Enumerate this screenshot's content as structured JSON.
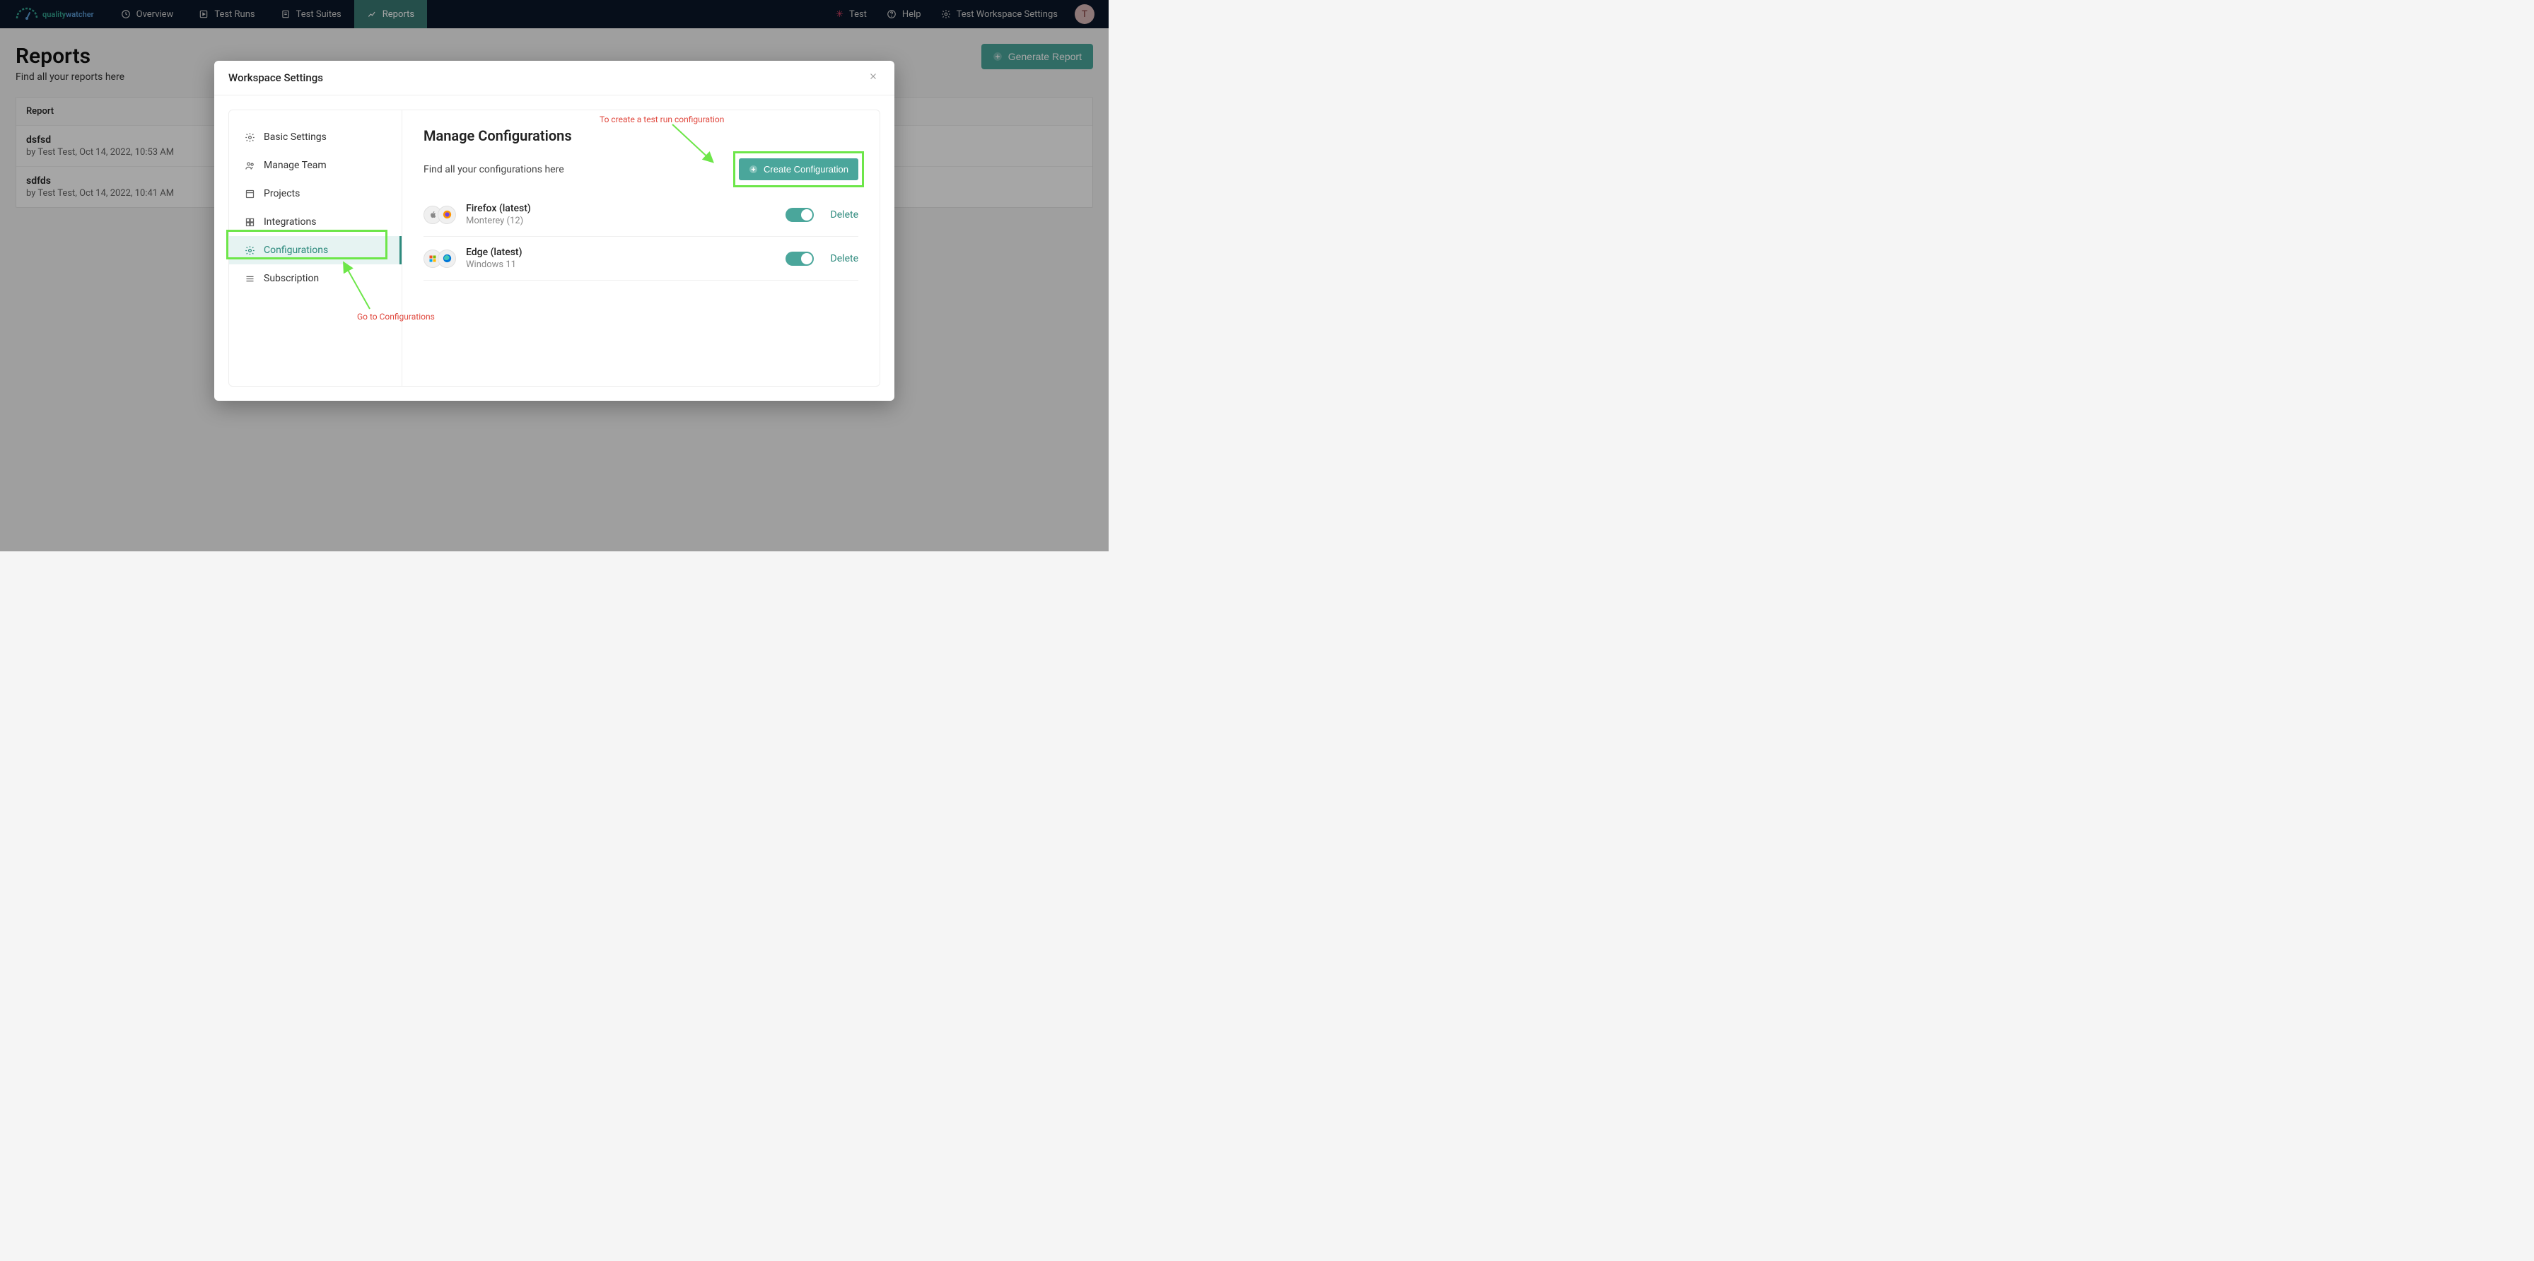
{
  "brand": {
    "name_a": "quality",
    "name_b": "watcher"
  },
  "nav": {
    "items": [
      {
        "label": "Overview"
      },
      {
        "label": "Test Runs"
      },
      {
        "label": "Test Suites"
      },
      {
        "label": "Reports"
      }
    ],
    "right": {
      "test": "Test",
      "help": "Help",
      "settings": "Test Workspace Settings",
      "avatar_initial": "T"
    }
  },
  "page": {
    "title": "Reports",
    "subtitle": "Find all your reports here",
    "generate_btn": "Generate Report",
    "column_header": "Report",
    "reports": [
      {
        "name": "dsfsd",
        "meta": "by Test Test, Oct 14, 2022, 10:53 AM"
      },
      {
        "name": "sdfds",
        "meta": "by Test Test, Oct 14, 2022, 10:41 AM"
      }
    ]
  },
  "modal": {
    "title": "Workspace Settings",
    "side": [
      {
        "label": "Basic Settings"
      },
      {
        "label": "Manage Team"
      },
      {
        "label": "Projects"
      },
      {
        "label": "Integrations"
      },
      {
        "label": "Configurations"
      },
      {
        "label": "Subscription"
      }
    ],
    "main": {
      "heading": "Manage Configurations",
      "sub": "Find all your configurations here",
      "create_btn": "Create Configuration",
      "delete_label": "Delete",
      "configs": [
        {
          "name": "Firefox (latest)",
          "os": "Monterey (12)"
        },
        {
          "name": "Edge (latest)",
          "os": "Windows 11"
        }
      ]
    }
  },
  "annotations": {
    "top": "To create a test run configuration",
    "bottom": "Go to Configurations"
  }
}
